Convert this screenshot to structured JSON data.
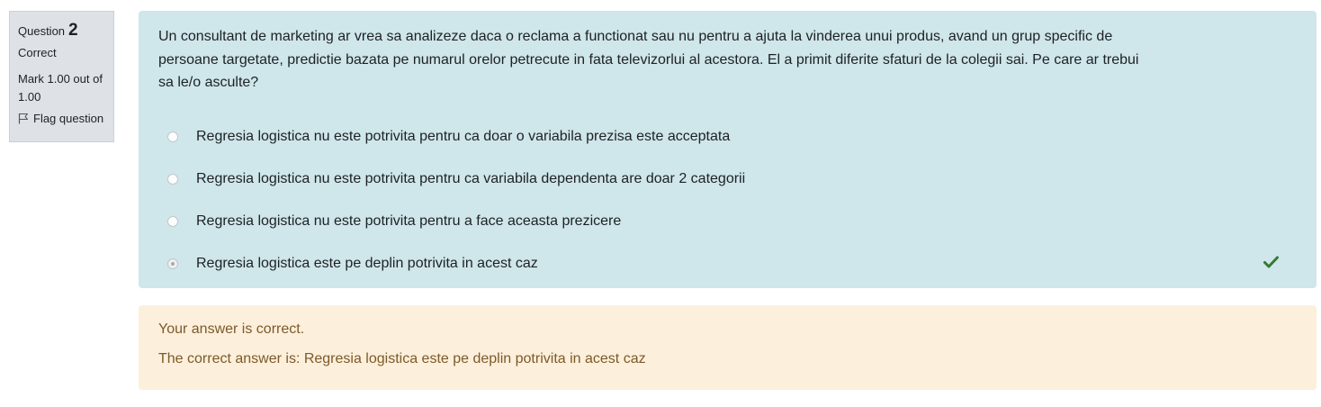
{
  "info": {
    "question_label": "Question",
    "question_number": "2",
    "state": "Correct",
    "grade": "Mark 1.00 out of 1.00",
    "flag_label": "Flag question"
  },
  "question": {
    "text": "Un consultant de marketing ar vrea sa analizeze daca o reclama a functionat sau nu pentru a ajuta la vinderea unui produs, avand un grup specific de persoane targetate, predictie bazata pe numarul orelor petrecute in fata televizorlui al acestora. El a primit diferite sfaturi de la colegii sai. Pe care ar trebui sa le/o asculte?",
    "answers": [
      {
        "label": "Regresia logistica nu este potrivita pentru ca doar o variabila prezisa este acceptata",
        "selected": false
      },
      {
        "label": "Regresia logistica nu este potrivita pentru ca variabila dependenta are doar 2 categorii",
        "selected": false
      },
      {
        "label": "Regresia logistica nu este potrivita pentru a face aceasta prezicere",
        "selected": false
      },
      {
        "label": "Regresia logistica este pe deplin potrivita in acest caz",
        "selected": true,
        "correct_icon": "check-icon"
      }
    ]
  },
  "outcome": {
    "feedback": "Your answer is correct.",
    "right_answer": "The correct answer is: Regresia logistica este pe deplin potrivita in acest caz"
  },
  "colors": {
    "formulation_bg": "#cfe6ea",
    "outcome_bg": "#fcefdc",
    "outcome_text": "#7d5a29",
    "correct_icon": "#357a32",
    "info_bg": "#dee2e6"
  }
}
